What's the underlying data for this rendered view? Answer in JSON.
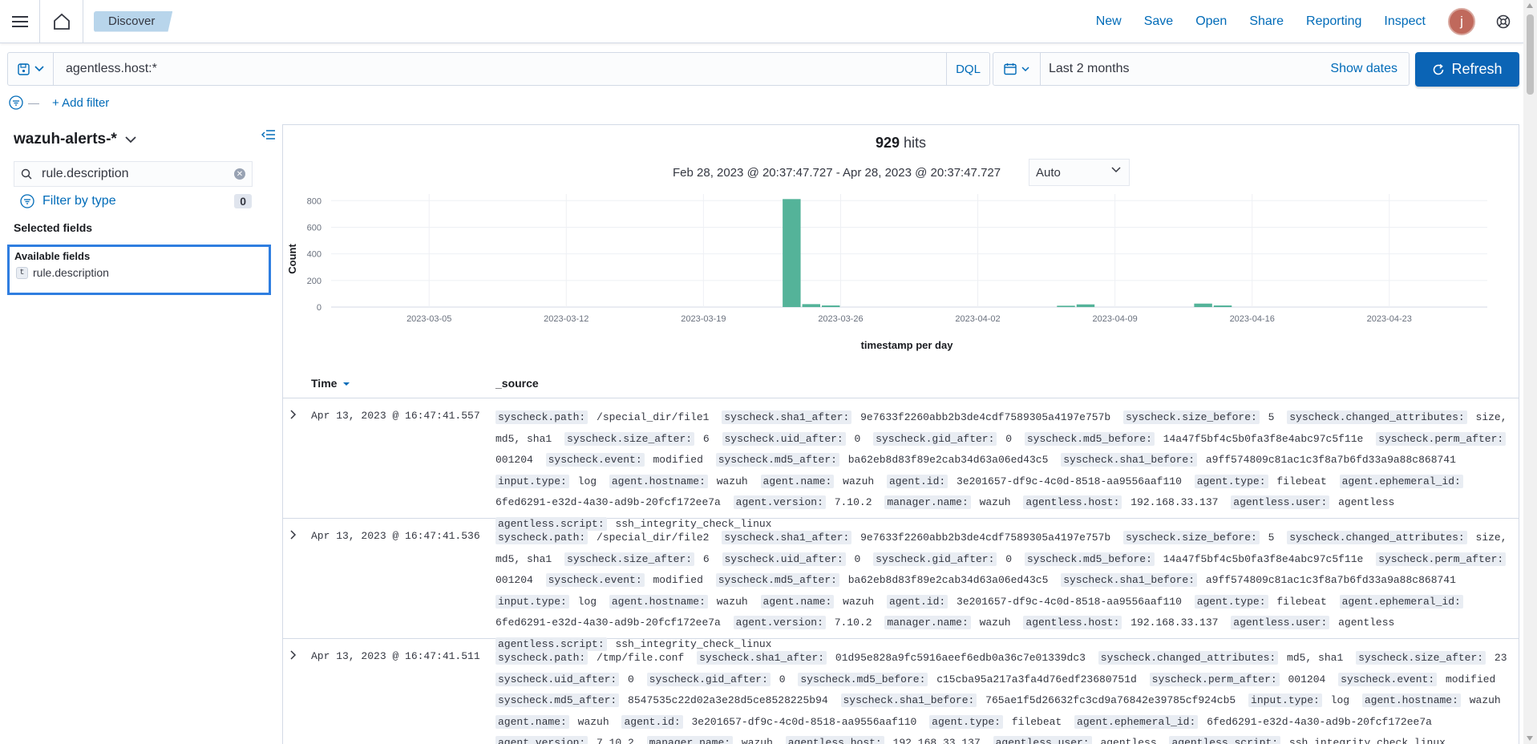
{
  "header": {
    "breadcrumb": "Discover",
    "menu": [
      "New",
      "Save",
      "Open",
      "Share",
      "Reporting",
      "Inspect"
    ],
    "avatar_initial": "j"
  },
  "query": {
    "value": "agentless.host:*",
    "language": "DQL"
  },
  "date_picker": {
    "range": "Last 2 months",
    "show_dates": "Show dates",
    "refresh": "Refresh"
  },
  "filters": {
    "add_filter": "+ Add filter"
  },
  "sidebar": {
    "index_pattern": "wazuh-alerts-*",
    "field_search": "rule.description",
    "filter_by_type": "Filter by type",
    "filter_count": "0",
    "selected_fields": "Selected fields",
    "available_fields": "Available fields",
    "fields": [
      {
        "type": "t",
        "name": "rule.description"
      }
    ]
  },
  "results": {
    "hits_count": "929",
    "hits_label": "hits",
    "time_range": "Feb 28, 2023 @ 20:37:47.727 - Apr 28, 2023 @ 20:37:47.727",
    "interval": "Auto",
    "columns": [
      "Time",
      "_source"
    ]
  },
  "chart_data": {
    "type": "bar",
    "xlabel": "timestamp per day",
    "ylabel": "Count",
    "ylim": [
      0,
      850
    ],
    "yticks": [
      0,
      200,
      400,
      600,
      800
    ],
    "x_ticks": [
      "2023-03-05",
      "2023-03-12",
      "2023-03-19",
      "2023-03-26",
      "2023-04-02",
      "2023-04-09",
      "2023-04-16",
      "2023-04-23"
    ],
    "x_range": [
      "2023-02-28",
      "2023-04-28"
    ],
    "bars": [
      {
        "x": "2023-03-23",
        "value": 812
      },
      {
        "x": "2023-03-24",
        "value": 22
      },
      {
        "x": "2023-03-25",
        "value": 12
      },
      {
        "x": "2023-04-06",
        "value": 10
      },
      {
        "x": "2023-04-07",
        "value": 20
      },
      {
        "x": "2023-04-13",
        "value": 26
      },
      {
        "x": "2023-04-14",
        "value": 12
      }
    ],
    "color": "#54b399",
    "grid": true
  },
  "rows": [
    {
      "time": "Apr 13, 2023 @ 16:47:41.557",
      "fields": [
        [
          "syscheck.path:",
          "/special_dir/file1"
        ],
        [
          "syscheck.sha1_after:",
          "9e7633f2260abb2b3de4cdf7589305a4197e757b"
        ],
        [
          "syscheck.size_before:",
          "5"
        ],
        [
          "syscheck.changed_attributes:",
          "size, md5, sha1"
        ],
        [
          "syscheck.size_after:",
          "6"
        ],
        [
          "syscheck.uid_after:",
          "0"
        ],
        [
          "syscheck.gid_after:",
          "0"
        ],
        [
          "syscheck.md5_before:",
          "14a47f5bf4c5b0fa3f8e4abc97c5f11e"
        ],
        [
          "syscheck.perm_after:",
          "001204"
        ],
        [
          "syscheck.event:",
          "modified"
        ],
        [
          "syscheck.md5_after:",
          "ba62eb8d83f89e2cab34d63a06ed43c5"
        ],
        [
          "syscheck.sha1_before:",
          "a9ff574809c81ac1c3f8a7b6fd33a9a88c868741"
        ],
        [
          "input.type:",
          "log"
        ],
        [
          "agent.hostname:",
          "wazuh"
        ],
        [
          "agent.name:",
          "wazuh"
        ],
        [
          "agent.id:",
          "3e201657-df9c-4c0d-8518-aa9556aaf110"
        ],
        [
          "agent.type:",
          "filebeat"
        ],
        [
          "agent.ephemeral_id:",
          "6fed6291-e32d-4a30-ad9b-20fcf172ee7a"
        ],
        [
          "agent.version:",
          "7.10.2"
        ],
        [
          "manager.name:",
          "wazuh"
        ],
        [
          "agentless.host:",
          "192.168.33.137"
        ],
        [
          "agentless.user:",
          "agentless"
        ],
        [
          "agentless.script:",
          "ssh_integrity_check_linux"
        ]
      ]
    },
    {
      "time": "Apr 13, 2023 @ 16:47:41.536",
      "fields": [
        [
          "syscheck.path:",
          "/special_dir/file2"
        ],
        [
          "syscheck.sha1_after:",
          "9e7633f2260abb2b3de4cdf7589305a4197e757b"
        ],
        [
          "syscheck.size_before:",
          "5"
        ],
        [
          "syscheck.changed_attributes:",
          "size, md5, sha1"
        ],
        [
          "syscheck.size_after:",
          "6"
        ],
        [
          "syscheck.uid_after:",
          "0"
        ],
        [
          "syscheck.gid_after:",
          "0"
        ],
        [
          "syscheck.md5_before:",
          "14a47f5bf4c5b0fa3f8e4abc97c5f11e"
        ],
        [
          "syscheck.perm_after:",
          "001204"
        ],
        [
          "syscheck.event:",
          "modified"
        ],
        [
          "syscheck.md5_after:",
          "ba62eb8d83f89e2cab34d63a06ed43c5"
        ],
        [
          "syscheck.sha1_before:",
          "a9ff574809c81ac1c3f8a7b6fd33a9a88c868741"
        ],
        [
          "input.type:",
          "log"
        ],
        [
          "agent.hostname:",
          "wazuh"
        ],
        [
          "agent.name:",
          "wazuh"
        ],
        [
          "agent.id:",
          "3e201657-df9c-4c0d-8518-aa9556aaf110"
        ],
        [
          "agent.type:",
          "filebeat"
        ],
        [
          "agent.ephemeral_id:",
          "6fed6291-e32d-4a30-ad9b-20fcf172ee7a"
        ],
        [
          "agent.version:",
          "7.10.2"
        ],
        [
          "manager.name:",
          "wazuh"
        ],
        [
          "agentless.host:",
          "192.168.33.137"
        ],
        [
          "agentless.user:",
          "agentless"
        ],
        [
          "agentless.script:",
          "ssh_integrity_check_linux"
        ]
      ]
    },
    {
      "time": "Apr 13, 2023 @ 16:47:41.511",
      "fields": [
        [
          "syscheck.path:",
          "/tmp/file.conf"
        ],
        [
          "syscheck.sha1_after:",
          "01d95e828a9fc5916aeef6edb0a36c7e01339dc3"
        ],
        [
          "syscheck.changed_attributes:",
          "md5, sha1"
        ],
        [
          "syscheck.size_after:",
          "23"
        ],
        [
          "syscheck.uid_after:",
          "0"
        ],
        [
          "syscheck.gid_after:",
          "0"
        ],
        [
          "syscheck.md5_before:",
          "c15cba95a217a3fa4d76edf23680751d"
        ],
        [
          "syscheck.perm_after:",
          "001204"
        ],
        [
          "syscheck.event:",
          "modified"
        ],
        [
          "syscheck.md5_after:",
          "8547535c22d02a3e28d5ce8528225b94"
        ],
        [
          "syscheck.sha1_before:",
          "765ae1f5d26632fc3cd9a76842e39785cf924cb5"
        ],
        [
          "input.type:",
          "log"
        ],
        [
          "agent.hostname:",
          "wazuh"
        ],
        [
          "agent.name:",
          "wazuh"
        ],
        [
          "agent.id:",
          "3e201657-df9c-4c0d-8518-aa9556aaf110"
        ],
        [
          "agent.type:",
          "filebeat"
        ],
        [
          "agent.ephemeral_id:",
          "6fed6291-e32d-4a30-ad9b-20fcf172ee7a"
        ],
        [
          "agent.version:",
          "7.10.2"
        ],
        [
          "manager.name:",
          "wazuh"
        ],
        [
          "agentless.host:",
          "192.168.33.137"
        ],
        [
          "agentless.user:",
          "agentless"
        ],
        [
          "agentless.script:",
          "ssh_integrity_check_linux"
        ]
      ]
    }
  ]
}
